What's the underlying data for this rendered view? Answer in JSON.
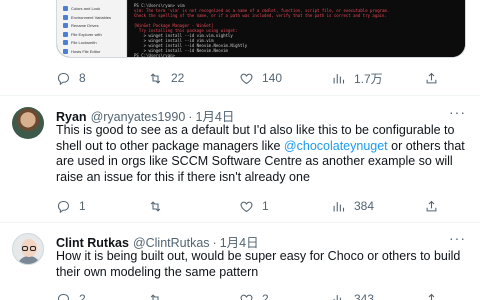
{
  "media": {
    "sidebar_items": [
      "Colors and Look",
      "Environment Variables",
      "Rename Drives",
      "File Explorer with",
      "File Locksmith",
      "Hosts File Editor"
    ],
    "terminal_lines": [
      {
        "text": "PS C:\\Users\\ryan> vim",
        "color": "#cccccc"
      },
      {
        "text": "vim: The term 'vim' is not recognized as a name of a cmdlet, function, script file, or executable program.",
        "color": "#e74856"
      },
      {
        "text": "Check the spelling of the name, or if a path was included, verify that the path is correct and try again.",
        "color": "#e74856"
      },
      {
        "text": "",
        "color": "#cccccc"
      },
      {
        "text": "[WinGet Package Manager - WinGet]",
        "color": "#e74856"
      },
      {
        "text": "  Try installing this package using winget:",
        "color": "#e74856"
      },
      {
        "text": "    > winget install --id vim.vim.nightly",
        "color": "#cccccc"
      },
      {
        "text": "    > winget install --id vim.vim",
        "color": "#cccccc"
      },
      {
        "text": "    > winget install --id Neovim.Neovim.Nightly",
        "color": "#cccccc"
      },
      {
        "text": "    > winget install --id Neovim.Neovim",
        "color": "#cccccc"
      },
      {
        "text": "PS C:\\Users\\ryan>",
        "color": "#cccccc"
      }
    ]
  },
  "tweet0": {
    "actions": {
      "replies": "8",
      "retweets": "22",
      "likes": "140",
      "views": "1.7万"
    }
  },
  "tweet1": {
    "name": "Ryan",
    "handle": "@ryanyates1990",
    "separator": "·",
    "date": "1月4日",
    "more": "···",
    "text_before": "This is good to see as a default but I'd also like this to be configurable to shell out to other package managers like ",
    "mention": "@chocolateynuget",
    "text_after": " or others that are used in orgs like SCCM Software Centre as another example so will raise an issue for this if there isn't already one",
    "actions": {
      "replies": "1",
      "retweets": "",
      "likes": "1",
      "views": "384"
    }
  },
  "tweet2": {
    "name": "Clint Rutkas",
    "handle": "@ClintRutkas",
    "separator": "·",
    "date": "1月4日",
    "more": "···",
    "text": "How it is being built out, would be super easy for Choco or others to build their own modeling the same pattern",
    "actions": {
      "replies": "2",
      "retweets": "",
      "likes": "2",
      "views": "343"
    }
  }
}
